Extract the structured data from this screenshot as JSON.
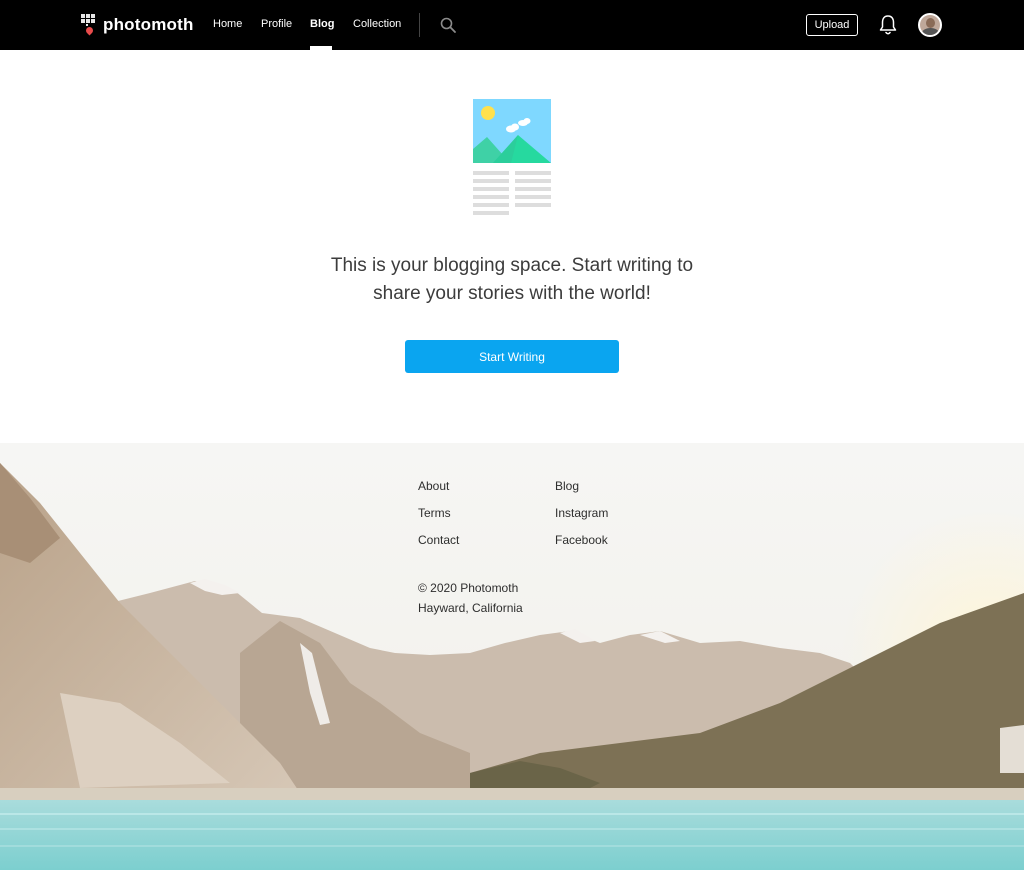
{
  "brand": {
    "name": "photomoth"
  },
  "nav": {
    "links": [
      {
        "label": "Home"
      },
      {
        "label": "Profile"
      },
      {
        "label": "Blog"
      },
      {
        "label": "Collection"
      }
    ],
    "active": "Blog",
    "upload_label": "Upload",
    "icons": [
      "search-icon",
      "bell-icon",
      "avatar"
    ]
  },
  "main": {
    "message_line1": "This is your blogging space. Start writing to",
    "message_line2": "share your stories with the world!",
    "cta_label": "Start Writing"
  },
  "footer": {
    "col1": [
      "About",
      "Terms",
      "Contact"
    ],
    "col2": [
      "Blog",
      "Instagram",
      "Facebook"
    ],
    "copyright": "© 2020 Photomoth",
    "location": "Hayward, California"
  },
  "colors": {
    "nav_bg": "#000000",
    "accent": "#0aa5f0",
    "logo_pin": "#e84b4b"
  }
}
